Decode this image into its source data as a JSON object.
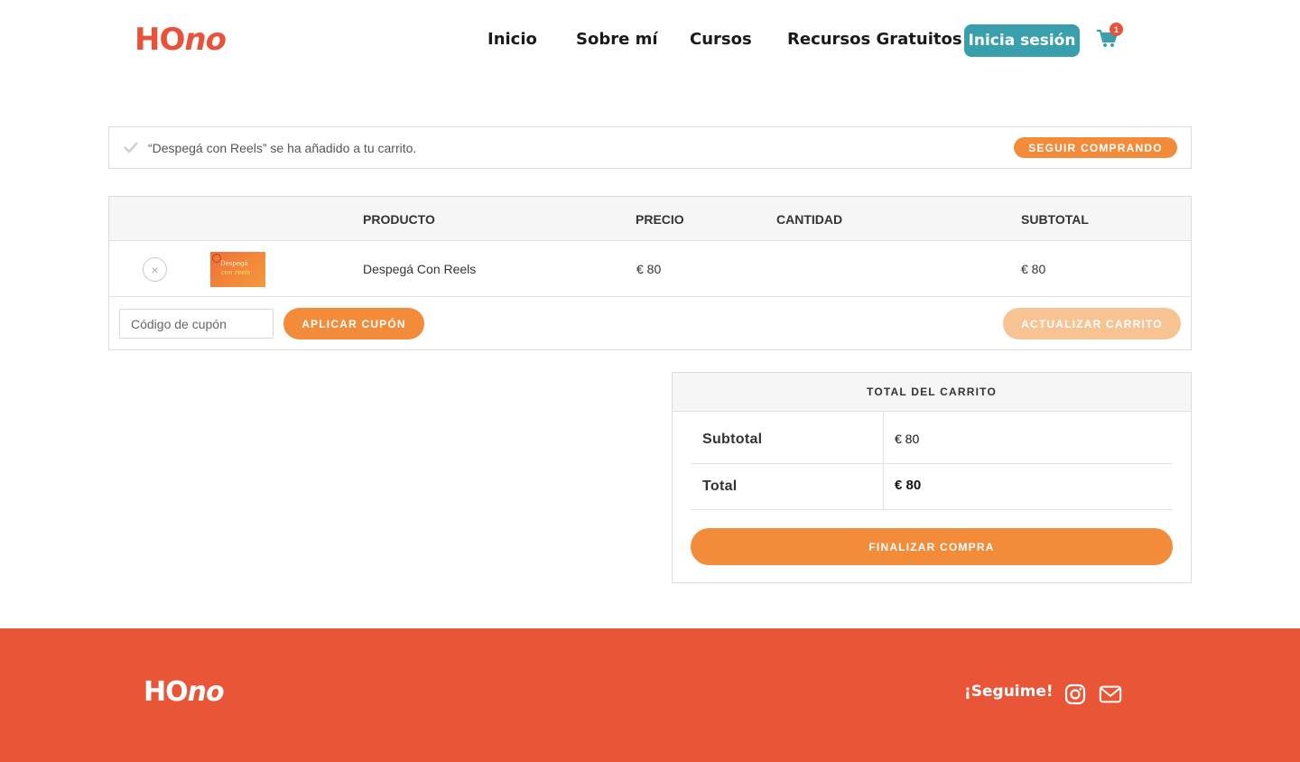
{
  "header": {
    "logo": {
      "part1": "HO",
      "part2": "no"
    },
    "nav": [
      {
        "label": "Inicio"
      },
      {
        "label": "Sobre mí"
      },
      {
        "label": "Cursos"
      },
      {
        "label": "Recursos Gratuitos"
      }
    ],
    "login_label": "Inicia sesión",
    "cart_count": "1",
    "cart_icon": "cart-icon"
  },
  "notice": {
    "message": "“Despegá con Reels” se ha añadido a tu carrito.",
    "button_label": "Seguir comprando",
    "icon": "check-icon"
  },
  "cart": {
    "columns": [
      "",
      "",
      "PRODUCTO",
      "PRECIO",
      "CANTIDAD",
      "SUBTOTAL"
    ],
    "items": [
      {
        "name": "Despegá Con Reels",
        "price": "€ 80",
        "quantity": "",
        "subtotal": "€ 80",
        "remove_symbol": "×",
        "thumbnail": {
          "line1": "Despegá",
          "line2": "con reels"
        }
      }
    ],
    "coupon_placeholder": "Código de cupón",
    "apply_label": "Aplicar cupón",
    "update_label": "Actualizar carrito"
  },
  "totals": {
    "heading": "TOTAL DEL CARRITO",
    "rows": [
      {
        "label": "Subtotal",
        "value": "€ 80"
      },
      {
        "label": "Total",
        "value": "€ 80"
      }
    ],
    "checkout_label": "Finalizar compra"
  },
  "footer": {
    "logo": {
      "part1": "HO",
      "part2": "no"
    },
    "follow_label": "¡Seguime!",
    "social": [
      "instagram-icon",
      "mail-icon"
    ]
  },
  "colors": {
    "brand_red": "#e85637",
    "accent_orange": "#f28b3a",
    "teal": "#3a9fac"
  }
}
